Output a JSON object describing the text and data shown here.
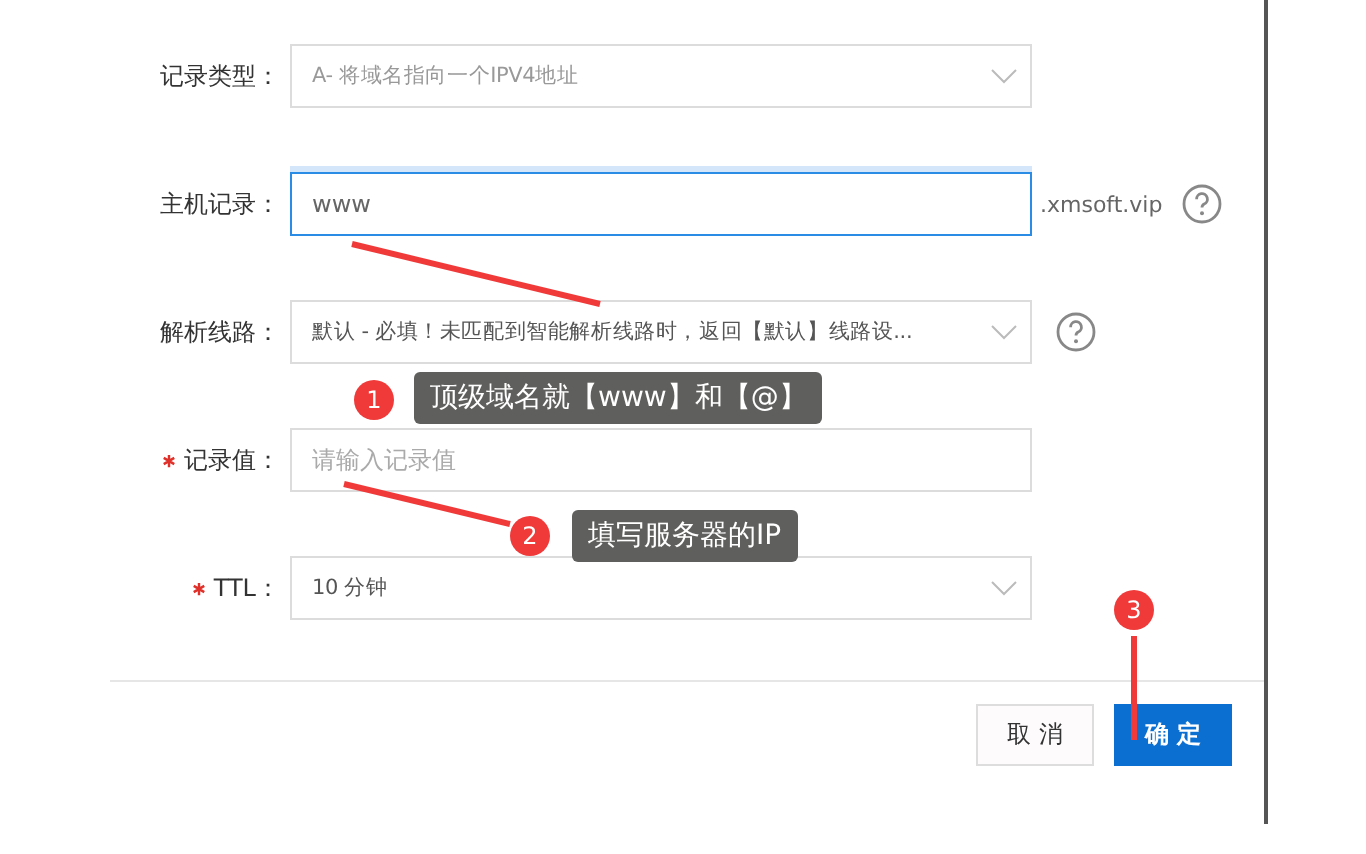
{
  "fields": [
    {
      "label": "记录类型：",
      "required": false,
      "kind": "select",
      "value": "A- 将域名指向一个IPV4地址",
      "disabled": true,
      "help": false
    },
    {
      "label": "主机记录：",
      "required": false,
      "kind": "input",
      "value": "www",
      "focused": true,
      "suffix": ".xmsoft.vip",
      "help": true
    },
    {
      "label": "解析线路：",
      "required": false,
      "kind": "select",
      "value": "默认 - 必填！未匹配到智能解析线路时，返回【默认】线路设...",
      "disabled": false,
      "help": true
    },
    {
      "label": "记录值：",
      "required": true,
      "kind": "input",
      "placeholder": "请输入记录值",
      "focused": false,
      "help": false
    },
    {
      "label": "TTL：",
      "required": true,
      "kind": "select",
      "value": "10 分钟",
      "disabled": false,
      "help": false
    }
  ],
  "buttons": [
    {
      "label": "取 消",
      "kind": "default"
    },
    {
      "label": "确 定",
      "kind": "primary"
    }
  ],
  "annotations": [
    {
      "number": "1",
      "text": "顶级域名就【www】和【@】"
    },
    {
      "number": "2",
      "text": "填写服务器的IP"
    },
    {
      "number": "3"
    }
  ]
}
